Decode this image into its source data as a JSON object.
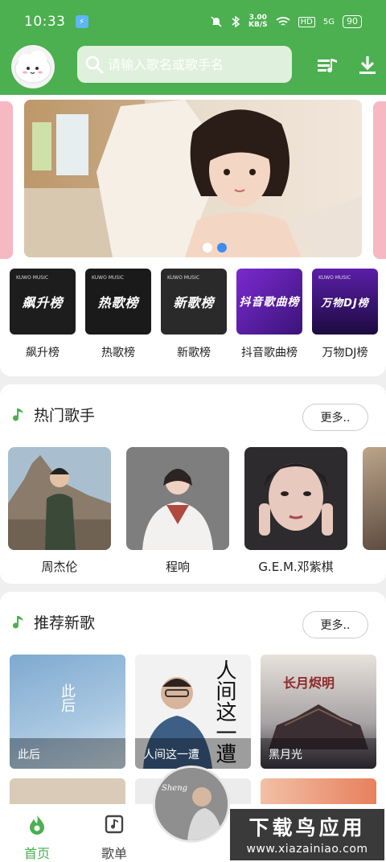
{
  "status_bar": {
    "time": "10:33",
    "speed_value": "3.00",
    "speed_unit": "KB/S",
    "hd": "HD",
    "net": "5G",
    "battery": "90"
  },
  "header": {
    "search_placeholder": "请输入歌名或歌手名",
    "avatar_icon": "cloud-mascot-icon",
    "playlist_icon": "playlist-icon",
    "download_icon": "download-icon"
  },
  "banner": {
    "slides": 2,
    "active_slide": 2
  },
  "charts": [
    {
      "title": "飙升榜",
      "label": "飙升榜",
      "bg": "#1d1d1d",
      "brand": "KUWO MUSIC"
    },
    {
      "title": "热歌榜",
      "label": "热歌榜",
      "bg": "#1a1a1a",
      "brand": "KUWO MUSIC"
    },
    {
      "title": "新歌榜",
      "label": "新歌榜",
      "bg": "#2a2a2a",
      "brand": "KUWO MUSIC"
    },
    {
      "title": "抖音歌曲榜",
      "label": "抖音歌曲榜",
      "bg": "#5a1fa0",
      "brand": ""
    },
    {
      "title": "万物DJ榜",
      "label": "万物DJ榜",
      "bg": "#3a1570",
      "brand": "KUWO MUSIC"
    }
  ],
  "hot_singers": {
    "title": "热门歌手",
    "more": "更多..",
    "items": [
      {
        "name": "周杰伦"
      },
      {
        "name": "程响"
      },
      {
        "name": "G.E.M.邓紫棋"
      }
    ]
  },
  "new_songs": {
    "title": "推荐新歌",
    "more": "更多..",
    "items": [
      {
        "title": "此后",
        "cover_text": "此后"
      },
      {
        "title": "人间这一遭",
        "cover_text": "人间这一遭"
      },
      {
        "title": "黑月光",
        "cover_text": "长月烬明"
      }
    ]
  },
  "bottom_nav": {
    "home": "首页",
    "playlist": "歌单"
  },
  "player": {
    "cover_text": "Sheng"
  },
  "watermark": {
    "line1": "下载鸟应用",
    "line2": "www.xiazainiao.com"
  },
  "colors": {
    "primary": "#4caf50",
    "accent_dot": "#3d8cf0"
  }
}
